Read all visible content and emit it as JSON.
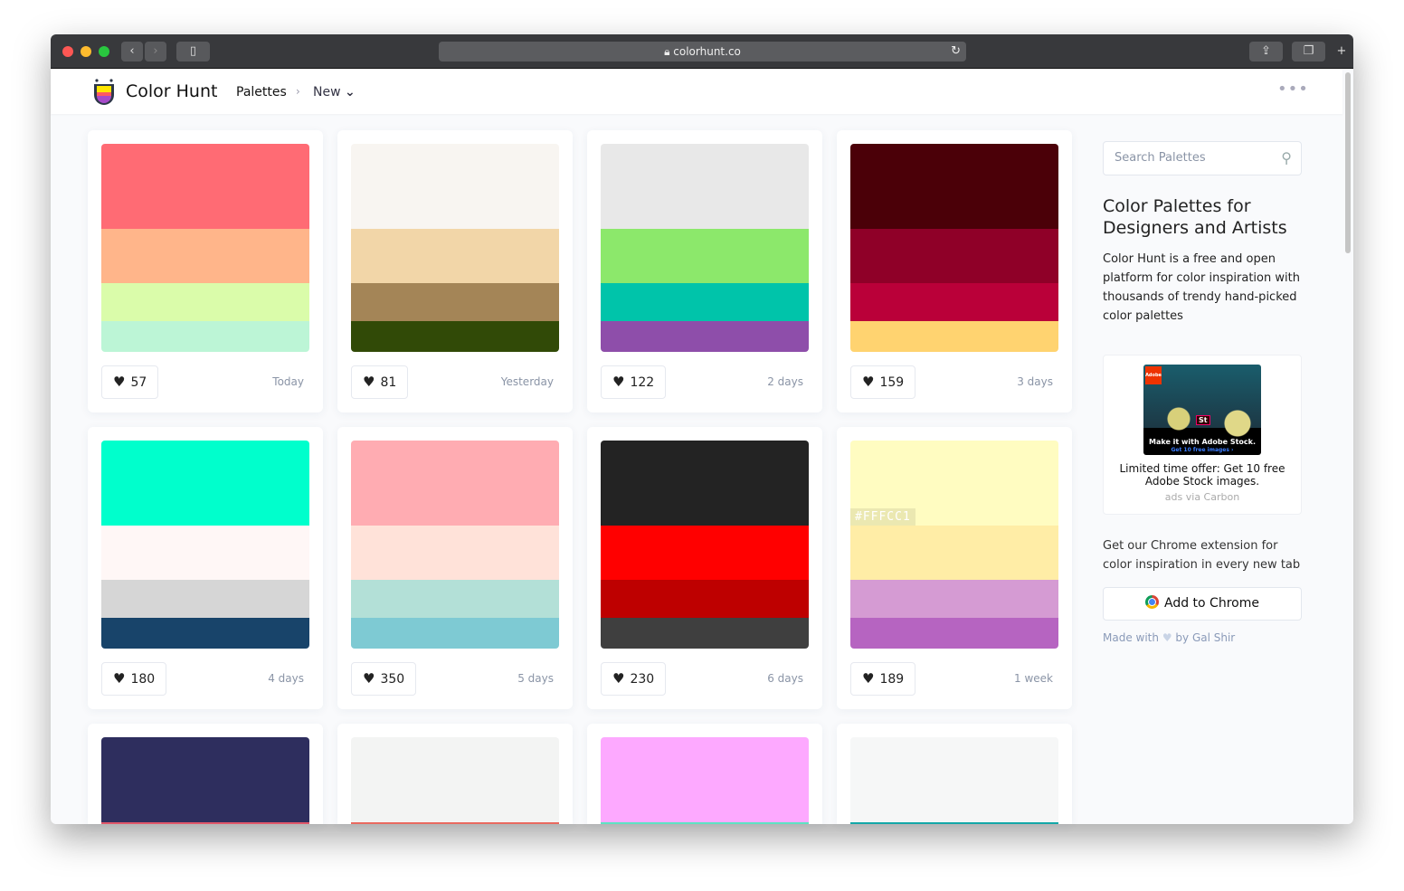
{
  "browser": {
    "url": "colorhunt.co",
    "back": "‹",
    "forward": "›"
  },
  "header": {
    "brand": "Color Hunt",
    "nav_palettes": "Palettes",
    "nav_separator": "›",
    "nav_new": "New",
    "nav_chevron": "⌄",
    "more": "•••"
  },
  "palettes": [
    {
      "colors": [
        "#FF6B74",
        "#FFB58A",
        "#DAFCAA",
        "#BCF5D6"
      ],
      "likes": "57",
      "date": "Today"
    },
    {
      "colors": [
        "#F8F5F1",
        "#F2D6A8",
        "#A48557",
        "#314A07"
      ],
      "likes": "81",
      "date": "Yesterday"
    },
    {
      "colors": [
        "#E8E8E8",
        "#8CE86B",
        "#00C4AA",
        "#8E4EAA"
      ],
      "likes": "122",
      "date": "2 days"
    },
    {
      "colors": [
        "#4B0008",
        "#8F0028",
        "#BA0039",
        "#FFD370"
      ],
      "likes": "159",
      "date": "3 days"
    },
    {
      "colors": [
        "#00FFCC",
        "#FFF7F6",
        "#D6D6D6",
        "#18446A"
      ],
      "likes": "180",
      "date": "4 days"
    },
    {
      "colors": [
        "#FFACB2",
        "#FFE2D9",
        "#B3E0D7",
        "#7ECAD3"
      ],
      "likes": "350",
      "date": "5 days"
    },
    {
      "colors": [
        "#232323",
        "#FF0000",
        "#BE0000",
        "#3F3F3F"
      ],
      "likes": "230",
      "date": "6 days",
      "hover_hex": ""
    },
    {
      "colors": [
        "#FFFCC1",
        "#FFEDA6",
        "#D59BD3",
        "#B664C1"
      ],
      "likes": "189",
      "date": "1 week",
      "hover_hex": "#FFFCC1"
    },
    {
      "colors": [
        "#2E2E5E",
        "#E0576A"
      ]
    },
    {
      "colors": [
        "#F3F4F3",
        "#E96A60"
      ]
    },
    {
      "colors": [
        "#FDA9FF",
        "#5DE3C3"
      ]
    },
    {
      "colors": [
        "#F6F7F7",
        "#13A7A8"
      ]
    }
  ],
  "sidebar": {
    "search_placeholder": "Search Palettes",
    "title": "Color Palettes for Designers and Artists",
    "description": "Color Hunt is a free and open platform for color inspiration with thousands of trendy hand-picked color palettes",
    "ad": {
      "headline": "Make it with Adobe Stock.",
      "subline": "Get 10 free images ›",
      "text": "Limited time offer: Get 10 free Adobe Stock images.",
      "via": "ads via Carbon",
      "brand": "Adobe",
      "badge": "St"
    },
    "extension_text": "Get our Chrome extension for color inspiration in every new tab",
    "add_to_chrome": "Add to Chrome",
    "made_with": "Made with",
    "by": "by Gal Shir"
  }
}
